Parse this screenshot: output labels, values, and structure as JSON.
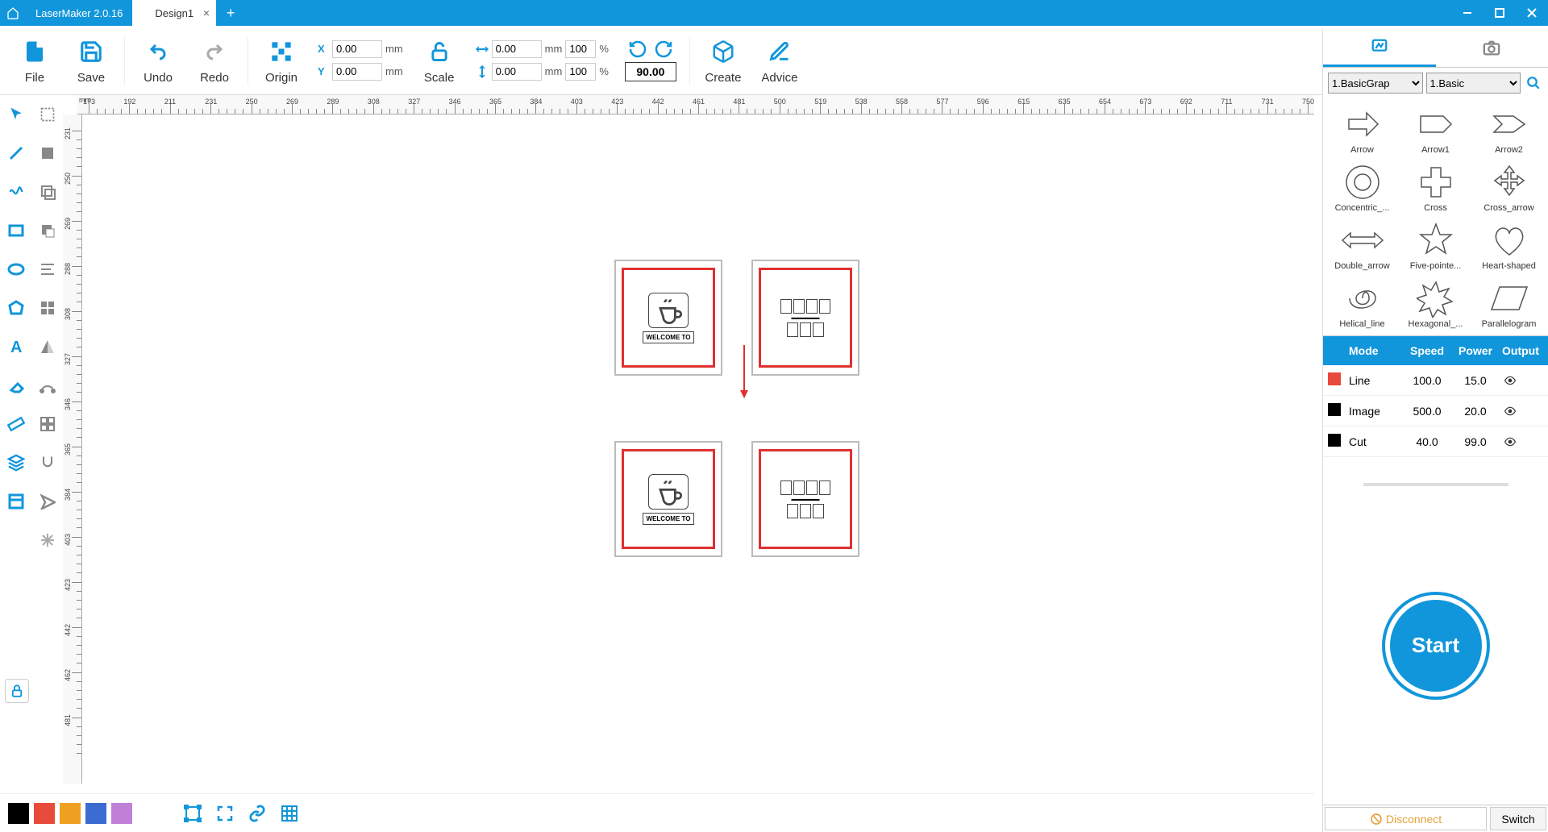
{
  "app": {
    "name": "LaserMaker 2.0.16",
    "tab": "Design1"
  },
  "toolbar": {
    "file": "File",
    "save": "Save",
    "undo": "Undo",
    "redo": "Redo",
    "origin": "Origin",
    "scale": "Scale",
    "create": "Create",
    "advice": "Advice",
    "x": "0.00",
    "y": "0.00",
    "w": "0.00",
    "h": "0.00",
    "sw": "100",
    "sh": "100",
    "rot": "90.00",
    "mm": "mm",
    "pct": "%",
    "xl": "X",
    "yl": "Y"
  },
  "ruler": {
    "unit": "mm"
  },
  "shapes": {
    "cat1": "1.BasicGrap",
    "cat2": "1.Basic",
    "items": [
      "Arrow",
      "Arrow1",
      "Arrow2",
      "Concentric_...",
      "Cross",
      "Cross_arrow",
      "Double_arrow",
      "Five-pointe...",
      "Heart-shaped",
      "Helical_line",
      "Hexagonal_...",
      "Parallelogram"
    ]
  },
  "modes": {
    "hdr": {
      "mode": "Mode",
      "speed": "Speed",
      "power": "Power",
      "output": "Output"
    },
    "rows": [
      {
        "color": "#e84b3c",
        "mode": "Line",
        "speed": "100.0",
        "power": "15.0"
      },
      {
        "color": "#000000",
        "mode": "Image",
        "speed": "500.0",
        "power": "20.0"
      },
      {
        "color": "#000000",
        "mode": "Cut",
        "speed": "40.0",
        "power": "99.0"
      }
    ]
  },
  "start": "Start",
  "footer": {
    "disconnect": "Disconnect",
    "switch": "Switch"
  },
  "swatches": [
    "#000000",
    "#e84b3c",
    "#f0a020",
    "#3b6cd4",
    "#c080d8"
  ],
  "canvas": {
    "welcome": "WELCOME TO"
  }
}
